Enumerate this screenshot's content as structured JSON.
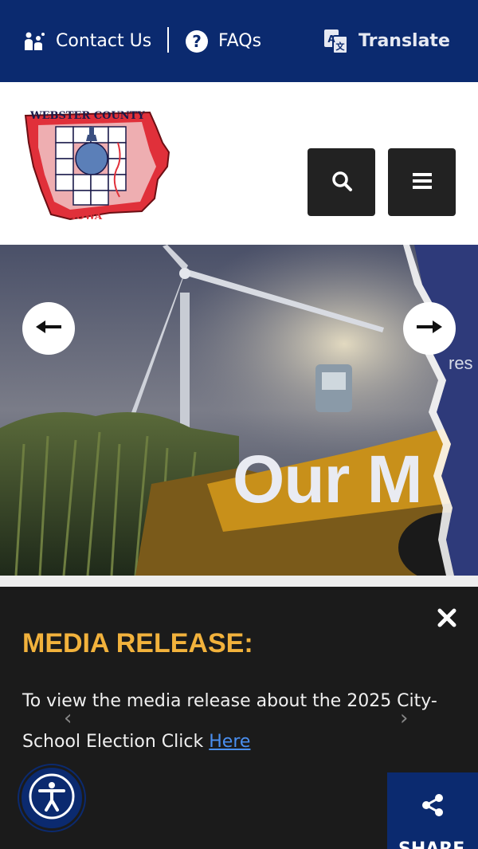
{
  "topbar": {
    "contact_label": "Contact Us",
    "faq_label": "FAQs",
    "translate_label": "Translate"
  },
  "header": {
    "logo_text_top": "WEBSTER COUNTY",
    "logo_text_bottom": "IOWA",
    "search_icon": "search-icon",
    "menu_icon": "hamburger-menu-icon"
  },
  "hero": {
    "small_text": "res",
    "big_text": "Our M",
    "prev_icon": "arrow-left-icon",
    "next_icon": "arrow-right-icon"
  },
  "alert": {
    "title": "MEDIA RELEASE:",
    "body_text": "To view the media release about the 2025 City-School Election Click ",
    "link_text": "Here",
    "prev_chevron": "‹",
    "next_chevron": "›"
  },
  "share": {
    "label": "SHARE"
  },
  "colors": {
    "navy": "#0b2a6f",
    "dark": "#1b1b1b",
    "accent": "#f2b23c",
    "link": "#4a8ff0"
  }
}
